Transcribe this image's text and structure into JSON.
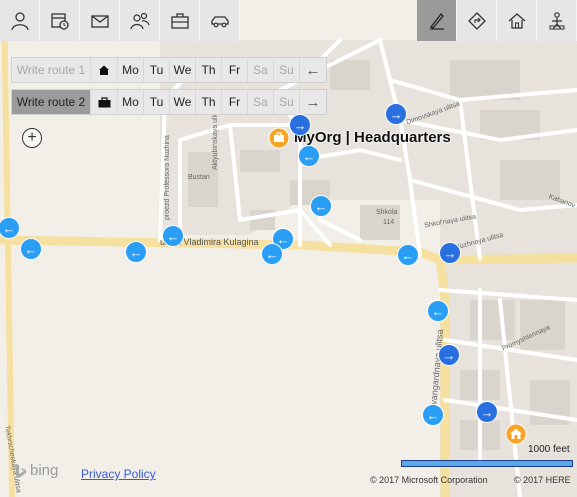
{
  "toolbar_left": [
    {
      "name": "person-icon"
    },
    {
      "name": "calendar-clock-icon"
    },
    {
      "name": "mail-icon"
    },
    {
      "name": "contacts-icon"
    },
    {
      "name": "briefcase-icon"
    },
    {
      "name": "car-icon"
    }
  ],
  "toolbar_right": [
    {
      "name": "pen-icon",
      "active": true
    },
    {
      "name": "directions-icon",
      "active": false
    },
    {
      "name": "home-icon",
      "active": false
    },
    {
      "name": "traveler-icon",
      "active": false
    }
  ],
  "route1": {
    "label": "Write route 1",
    "days": [
      "Mo",
      "Tu",
      "We",
      "Th",
      "Fr",
      "Sa",
      "Su"
    ],
    "icon": "home-icon",
    "arrow": "←"
  },
  "route2": {
    "label": "Write route 2",
    "days": [
      "Mo",
      "Tu",
      "We",
      "Th",
      "Fr",
      "Sa",
      "Su"
    ],
    "icon": "briefcase-icon",
    "arrow": "→"
  },
  "zoom": {
    "label": "+"
  },
  "headquarters": {
    "label": "MyOrg | Headquarters"
  },
  "map_labels": {
    "bustan": "Bustan",
    "shkola": "Shkola",
    "shkola_num": "114",
    "kulaga": "ulitsa Vladimira Kulagina",
    "aktyubinskaya": "Aktyubinskaya ulitsa",
    "nuzhina": "proezd Professora Nuzhina",
    "tekhnicheskaya": "Tekhnicheskaya ulitsa",
    "avangardnaya": "Avangardnaya ulitsa",
    "shkolnaya": "Shkol'naya ulitsa",
    "promyshlennaya": "Promyshlennaya",
    "kabanova": "Kabanov",
    "yuzhnaya": "Yuzhnaya ulitsa",
    "dimovskaya": "Dimovskaya ulitsa"
  },
  "markers": {
    "left_arrow": "←",
    "right_arrow": "→"
  },
  "colors": {
    "marker_light": "#2a9df4",
    "marker_dark": "#2a6fe0",
    "hq_orange": "#f7a325",
    "road": "#f8e6a0"
  },
  "footer": {
    "bing": "bing",
    "privacy": "Privacy Policy",
    "copyright_ms": "© 2017 Microsoft Corporation",
    "copyright_here": "© 2017 HERE",
    "scale": "1000 feet"
  }
}
